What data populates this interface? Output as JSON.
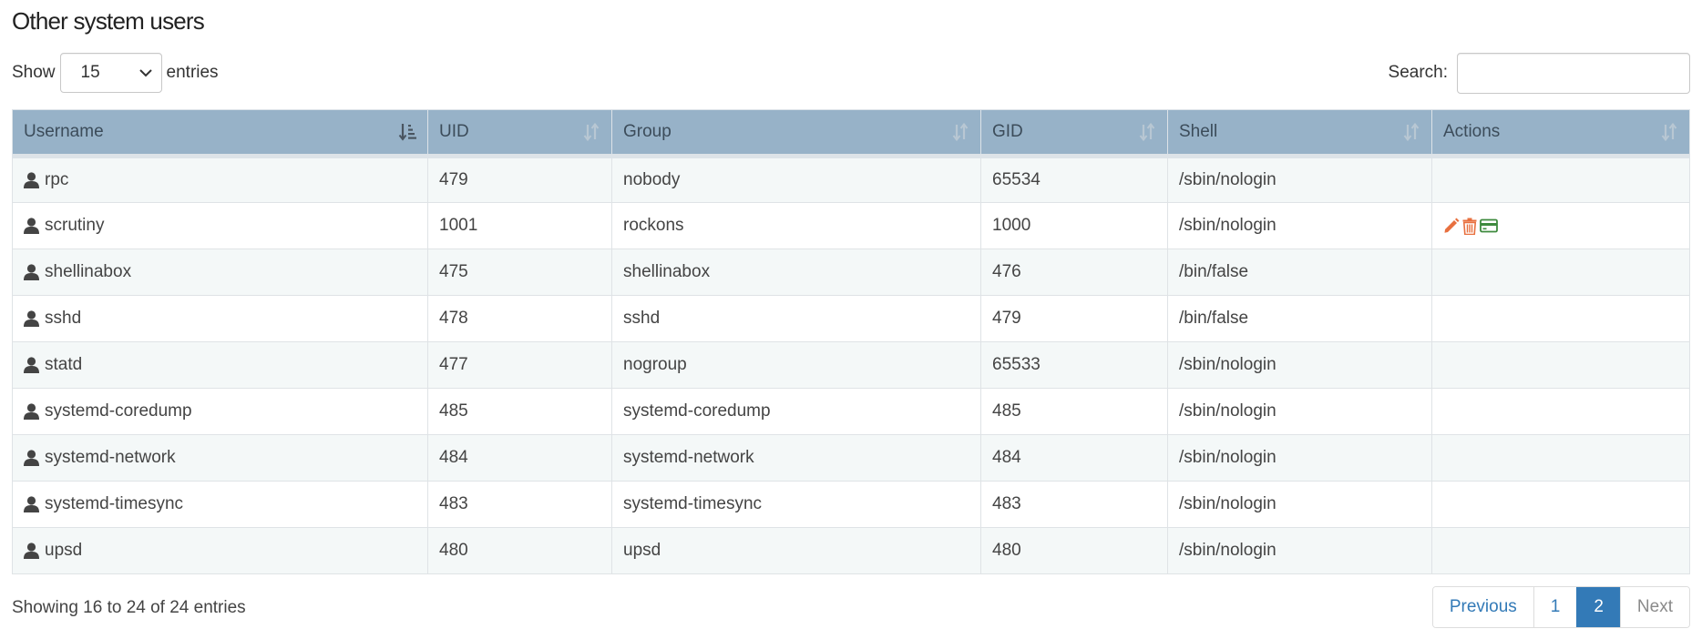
{
  "title": "Other system users",
  "length": {
    "show_label": "Show",
    "selected": "15",
    "entries_label": "entries"
  },
  "search": {
    "label": "Search:",
    "value": "",
    "placeholder": ""
  },
  "columns": [
    "Username",
    "UID",
    "Group",
    "GID",
    "Shell",
    "Actions"
  ],
  "rows": [
    {
      "username": "rpc",
      "uid": "479",
      "group": "nobody",
      "gid": "65534",
      "shell": "/sbin/nologin",
      "actions": []
    },
    {
      "username": "scrutiny",
      "uid": "1001",
      "group": "rockons",
      "gid": "1000",
      "shell": "/sbin/nologin",
      "actions": [
        "edit-icon",
        "trash-icon",
        "credit-card-icon"
      ]
    },
    {
      "username": "shellinabox",
      "uid": "475",
      "group": "shellinabox",
      "gid": "476",
      "shell": "/bin/false",
      "actions": []
    },
    {
      "username": "sshd",
      "uid": "478",
      "group": "sshd",
      "gid": "479",
      "shell": "/bin/false",
      "actions": []
    },
    {
      "username": "statd",
      "uid": "477",
      "group": "nogroup",
      "gid": "65533",
      "shell": "/sbin/nologin",
      "actions": []
    },
    {
      "username": "systemd-coredump",
      "uid": "485",
      "group": "systemd-coredump",
      "gid": "485",
      "shell": "/sbin/nologin",
      "actions": []
    },
    {
      "username": "systemd-network",
      "uid": "484",
      "group": "systemd-network",
      "gid": "484",
      "shell": "/sbin/nologin",
      "actions": []
    },
    {
      "username": "systemd-timesync",
      "uid": "483",
      "group": "systemd-timesync",
      "gid": "483",
      "shell": "/sbin/nologin",
      "actions": []
    },
    {
      "username": "upsd",
      "uid": "480",
      "group": "upsd",
      "gid": "480",
      "shell": "/sbin/nologin",
      "actions": []
    }
  ],
  "info": "Showing 16 to 24 of 24 entries",
  "pagination": {
    "previous": "Previous",
    "pages": [
      "1",
      "2"
    ],
    "current": "2",
    "next": "Next"
  },
  "colors": {
    "header_bg": "#97b2c8",
    "edit_icon": "#e8703f",
    "trash_icon": "#e8703f",
    "card_icon": "#3e8a3e",
    "link": "#337ab7"
  }
}
